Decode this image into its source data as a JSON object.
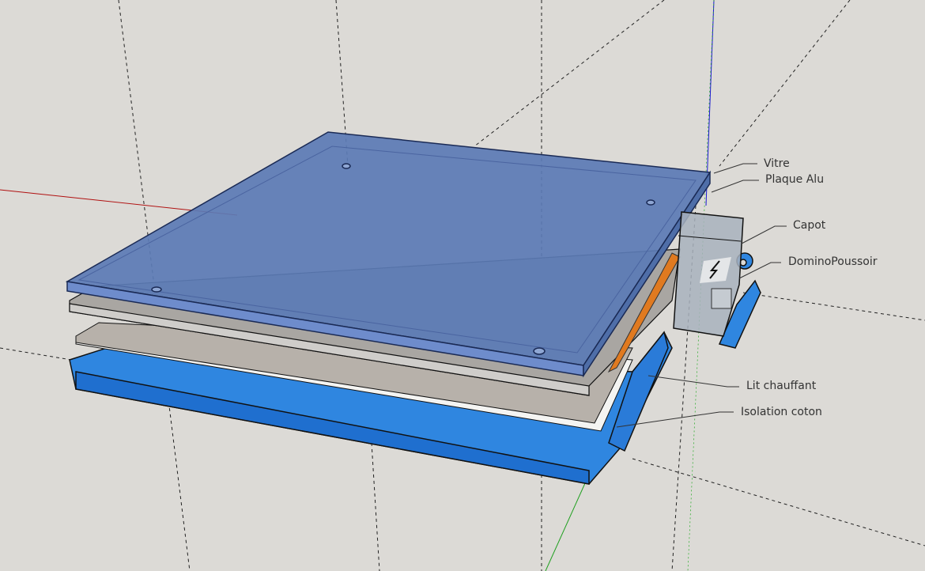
{
  "labels": {
    "vitre": "Vitre",
    "plaque_alu": "Plaque Alu",
    "capot": "Capot",
    "domino": "DominoPoussoir",
    "lit": "Lit chauffant",
    "isolation": "Isolation coton"
  },
  "colors": {
    "background": "#dcdad6",
    "glass": "#5b7bb5",
    "tray": "#2f86e0",
    "alu": "#b9b6b1",
    "heater": "#e07a20"
  }
}
